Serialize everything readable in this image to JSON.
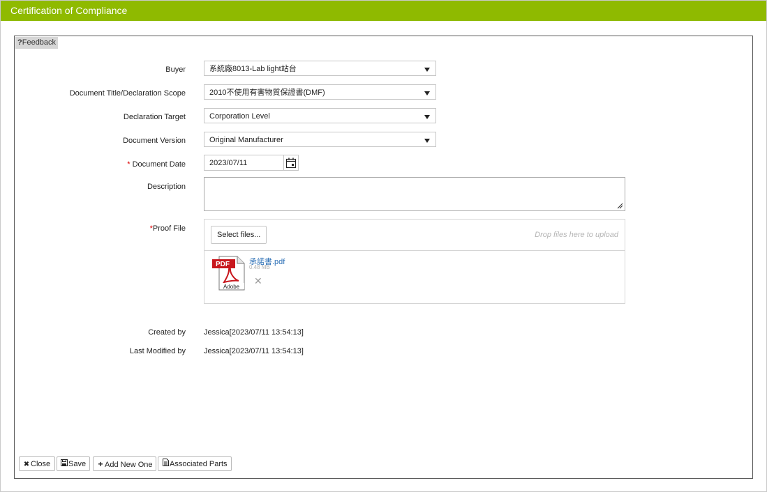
{
  "window": {
    "title": "Certification of Compliance"
  },
  "feedback": {
    "label": "Feedback",
    "icon": "question-icon"
  },
  "form": {
    "buyer": {
      "label": "Buyer",
      "value": "系統廠8013-Lab light站台"
    },
    "document_title": {
      "label": "Document Title/Declaration Scope",
      "value": "2010不使用有害物質保證書(DMF)"
    },
    "declaration_target": {
      "label": "Declaration Target",
      "value": "Corporation Level"
    },
    "document_version": {
      "label": "Document Version",
      "value": "Original Manufacturer"
    },
    "document_date": {
      "required": "*",
      "label": " Document Date",
      "value": "2023/07/11"
    },
    "description": {
      "label": "Description",
      "value": ""
    },
    "proof_file": {
      "required": "*",
      "label": "Proof File",
      "select_label": "Select files...",
      "drop_hint": "Drop files here to upload",
      "file": {
        "name": "承諾書.pdf",
        "size": "0.48 MB",
        "icon_text": "PDF",
        "icon_brand": "Adobe"
      }
    }
  },
  "info": {
    "created_by": {
      "label": "Created by",
      "value": "Jessica[2023/07/11 13:54:13]"
    },
    "last_modified_by": {
      "label": "Last Modified by",
      "value": "Jessica[2023/07/11 13:54:13]"
    }
  },
  "buttons": {
    "close": "Close",
    "save": "Save",
    "add_new": "Add New One",
    "associated_parts": "Associated Parts"
  },
  "colors": {
    "titlebar": "#8fba00",
    "required": "#dd0000",
    "link": "#2a6eb5"
  }
}
